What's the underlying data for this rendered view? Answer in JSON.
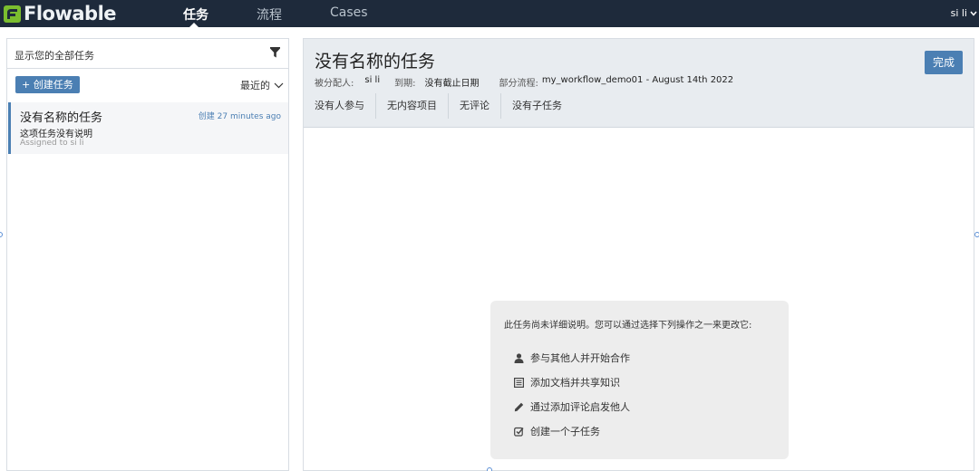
{
  "app": {
    "logo_text": "Flowable",
    "nav_tabs": [
      {
        "label": "任务",
        "active": true
      },
      {
        "label": "流程",
        "active": false
      },
      {
        "label": "Cases",
        "active": false
      }
    ],
    "user": "si li"
  },
  "task_list": {
    "filter_label": "显示您的全部任务",
    "create_button": "+ 创建任务",
    "sort_label": "最近的",
    "items": [
      {
        "title": "没有名称的任务",
        "created": "创建 27 minutes ago",
        "description": "这项任务没有说明",
        "assigned": "Assigned to si li"
      }
    ]
  },
  "task_detail": {
    "title": "没有名称的任务",
    "done_button": "完成",
    "meta": {
      "assignee_label": "被分配人:",
      "assignee_value": "si li",
      "due_label": "到期:",
      "due_value": "没有截止日期",
      "process_label": "部分流程:",
      "process_value": "my_workflow_demo01 - August 14th 2022"
    },
    "sub_tabs": [
      "没有人参与",
      "无内容项目",
      "无评论",
      "没有子任务"
    ],
    "empty_state": {
      "intro": "此任务尚未详细说明。您可以通过选择下列操作之一来更改它:",
      "actions": [
        {
          "label": "参与其他人并开始合作",
          "icon": "person-icon"
        },
        {
          "label": "添加文档并共享知识",
          "icon": "document-icon"
        },
        {
          "label": "通过添加评论启发他人",
          "icon": "pencil-icon"
        },
        {
          "label": "创建一个子任务",
          "icon": "checkbox-icon"
        }
      ]
    }
  },
  "colors": {
    "navbar": "#1e2a3b",
    "accent": "#4b7fb3",
    "logo_green": "#7bbd2f",
    "header_bg": "#e8ecf0"
  }
}
